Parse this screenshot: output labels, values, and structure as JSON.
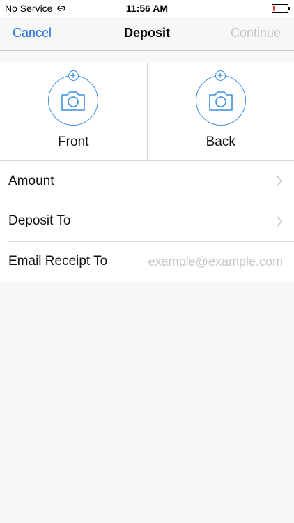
{
  "status_bar": {
    "carrier": "No Service",
    "time": "11:56 AM",
    "battery_level": 0.15,
    "battery_color": "#e53935"
  },
  "nav": {
    "cancel_label": "Cancel",
    "title": "Deposit",
    "continue_label": "Continue"
  },
  "capture": {
    "front_label": "Front",
    "back_label": "Back",
    "icon": "camera-add-icon",
    "accent": "#3d8fe0"
  },
  "form": {
    "amount_label": "Amount",
    "deposit_to_label": "Deposit To",
    "email_label": "Email Receipt To",
    "email_value": "",
    "email_placeholder": "example@example.com"
  },
  "colors": {
    "link": "#1f6fd6",
    "disabled": "#c4c4c8",
    "background": "#f7f7f7"
  }
}
